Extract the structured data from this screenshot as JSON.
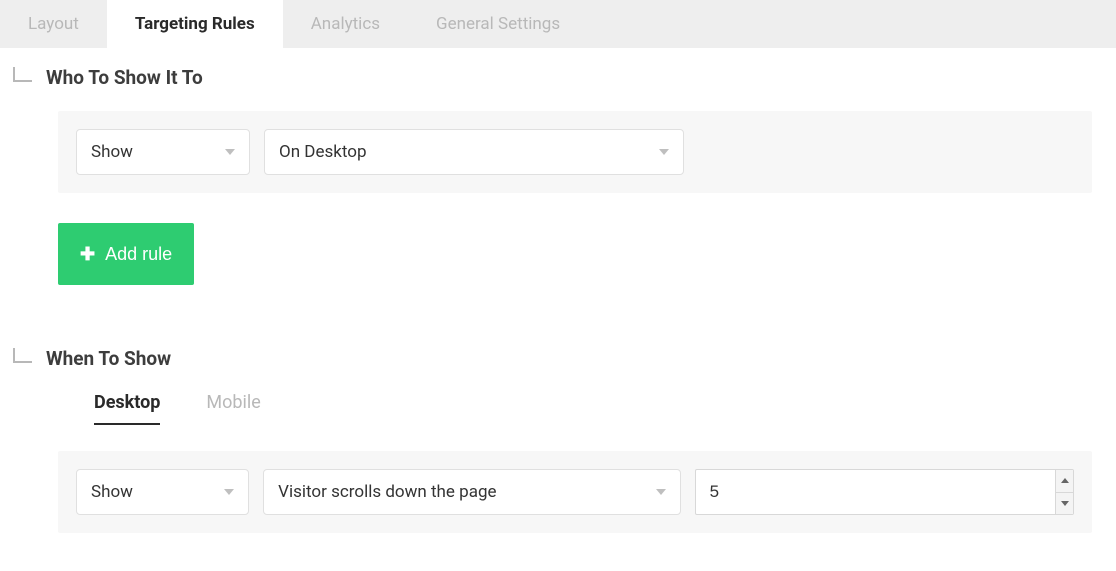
{
  "tabs": [
    {
      "label": "Layout",
      "active": false
    },
    {
      "label": "Targeting Rules",
      "active": true
    },
    {
      "label": "Analytics",
      "active": false
    },
    {
      "label": "General Settings",
      "active": false
    }
  ],
  "who_section": {
    "title": "Who To Show It To",
    "rule": {
      "action": "Show",
      "condition": "On Desktop"
    },
    "add_rule_label": "Add rule"
  },
  "when_section": {
    "title": "When To Show",
    "sub_tabs": [
      {
        "label": "Desktop",
        "active": true
      },
      {
        "label": "Mobile",
        "active": false
      }
    ],
    "rule": {
      "action": "Show",
      "condition": "Visitor scrolls down the page",
      "value": "5"
    }
  }
}
